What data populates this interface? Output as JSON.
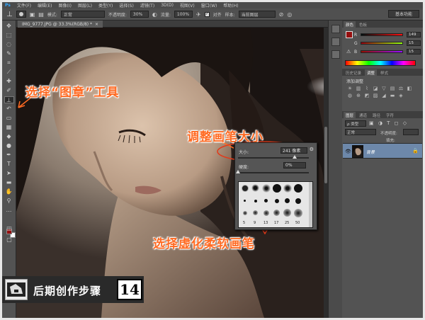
{
  "menubar": {
    "items": [
      "文件(F)",
      "编辑(E)",
      "图像(I)",
      "图层(L)",
      "类型(Y)",
      "选择(S)",
      "滤镜(T)",
      "3D(D)",
      "视图(V)",
      "窗口(W)",
      "帮助(H)"
    ]
  },
  "options": {
    "mode_label": "模式:",
    "mode_value": "正常",
    "opacity_label": "不透明度:",
    "opacity_value": "30%",
    "flow_label": "流量:",
    "flow_value": "100%",
    "aligned_label": "对齐",
    "sample_label": "样本:",
    "sample_value": "当前图层",
    "workspace": "基本功能"
  },
  "document": {
    "tab_title": "IMG_9777.JPG @ 33.3%(RGB/8) *",
    "close": "×"
  },
  "annotations": {
    "tool": "选择“图章”工具",
    "brush_size": "调整画笔大小",
    "soft_brush": "选择虚化柔软画笔"
  },
  "brush_picker": {
    "size_label": "大小:",
    "size_value": "241 像素",
    "hardness_label": "硬度:",
    "hardness_value": "0%",
    "size_fraction": 0.8,
    "hardness_fraction": 0.0,
    "labels": [
      "5",
      "9",
      "13",
      "17",
      "25",
      "50"
    ]
  },
  "panels": {
    "color_tabs": [
      "颜色",
      "色板"
    ],
    "r": "149",
    "g": "15",
    "b": "15",
    "adjust_tabs": [
      "历史记录",
      "调整",
      "样式"
    ],
    "adjust_title": "添加调整",
    "layer_tabs": [
      "图层",
      "通道",
      "路径",
      "字符"
    ],
    "blend_mode": "正常",
    "opacity": "不透明度:",
    "fill": "填充:",
    "layer_name": "背景"
  },
  "colors": {
    "foreground": "#950f0f",
    "background": "#ffffff",
    "annotation": "#ff6a22"
  },
  "badge": {
    "text": "后期创作步骤",
    "number": "14"
  }
}
